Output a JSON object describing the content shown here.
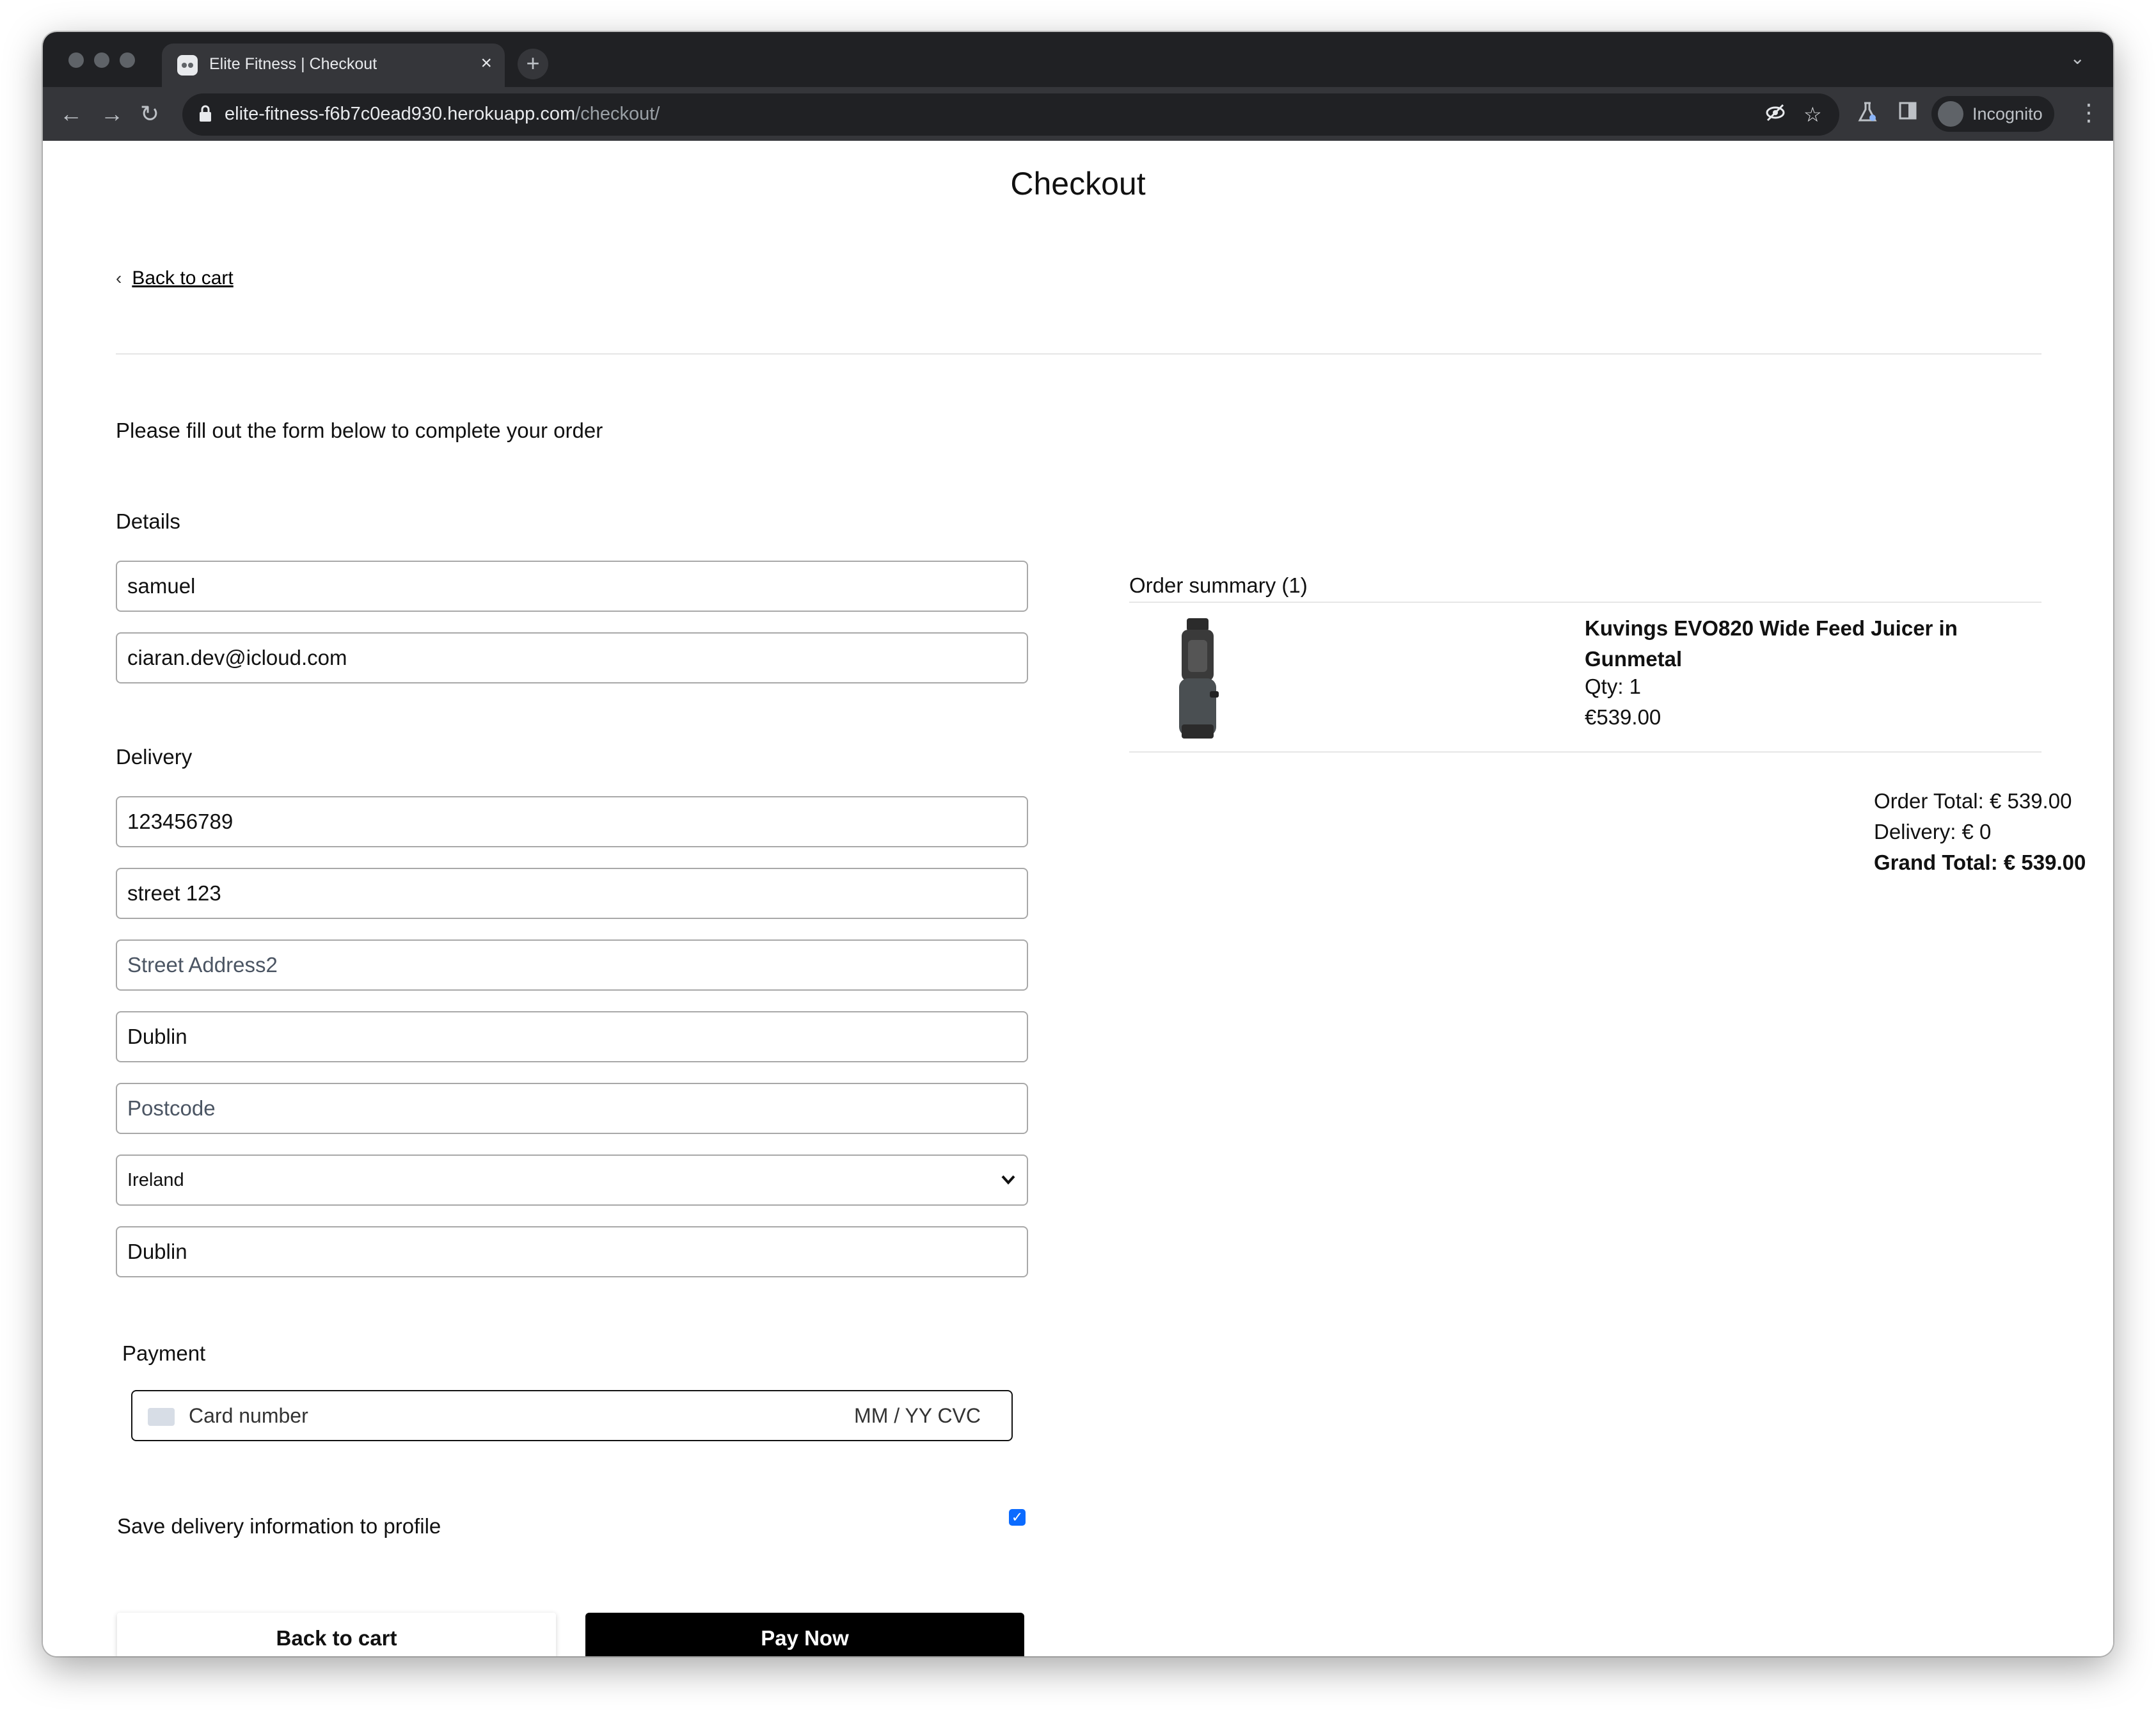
{
  "browser": {
    "tab_title": "Elite Fitness | Checkout",
    "url_host": "elite-fitness-f6b7c0ead930.herokuapp.com",
    "url_path": "/checkout/",
    "profile_label": "Incognito"
  },
  "page": {
    "title": "Checkout",
    "back_link": "Back to cart",
    "intro": "Please fill out the form below to complete your order"
  },
  "details": {
    "heading": "Details",
    "full_name": "samuel",
    "email": "ciaran.dev@icloud.com"
  },
  "delivery": {
    "heading": "Delivery",
    "phone": "123456789",
    "street1": "street 123",
    "street2_placeholder": "Street Address2",
    "town": "Dublin",
    "postcode_placeholder": "Postcode",
    "country": "Ireland",
    "county": "Dublin"
  },
  "payment": {
    "heading": "Payment",
    "card_placeholder": "Card number",
    "exp_cvc_placeholder": "MM / YY  CVC"
  },
  "save_info": {
    "label": "Save delivery information to profile",
    "checked": true
  },
  "buttons": {
    "back": "Back to cart",
    "pay": "Pay Now"
  },
  "summary": {
    "heading": "Order summary (1)",
    "items": [
      {
        "name": "Kuvings EVO820 Wide Feed Juicer in Gunmetal",
        "qty": "Qty: 1",
        "price": "€539.00"
      }
    ],
    "order_total": "Order Total: € 539.00",
    "delivery": "Delivery: € 0",
    "grand_total": "Grand Total: € 539.00"
  }
}
